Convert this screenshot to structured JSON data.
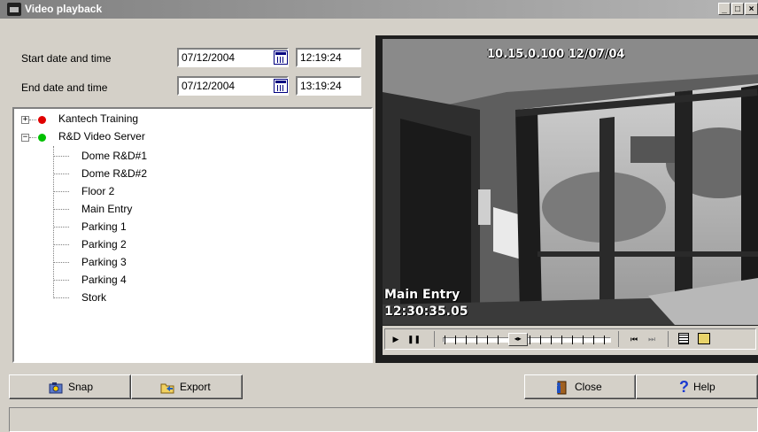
{
  "window": {
    "title": "Video playback",
    "minimize": "_",
    "maximize": "□",
    "close": "×"
  },
  "range": {
    "start_label": "Start date and time",
    "start_date": "07/12/2004",
    "start_time": "12:19:24",
    "end_label": "End date and time",
    "end_date": "07/12/2004",
    "end_time": "13:19:24"
  },
  "tree": {
    "servers": [
      {
        "label": "Kantech Training",
        "expander": "+",
        "status_color": "#e00000"
      },
      {
        "label": "R&D Video Server",
        "expander": "−",
        "status_color": "#00c000"
      }
    ],
    "cameras": [
      "Dome R&D#1",
      "Dome R&D#2",
      "Floor 2",
      "Main Entry",
      "Parking 1",
      "Parking 2",
      "Parking 3",
      "Parking 4",
      "Stork"
    ]
  },
  "video": {
    "header_overlay": "10.15.0.100 12/07/04",
    "camera_name": "Main Entry",
    "timestamp": "12:30:35.05",
    "position": 0.45
  },
  "controls": [
    "play-icon",
    "pause-icon",
    "timeline-slider",
    "skip-start-icon",
    "skip-end-icon",
    "details-icon",
    "snapshot-view-icon"
  ],
  "buttons": {
    "snap": "Snap",
    "export": "Export",
    "close": "Close",
    "help": "Help"
  }
}
